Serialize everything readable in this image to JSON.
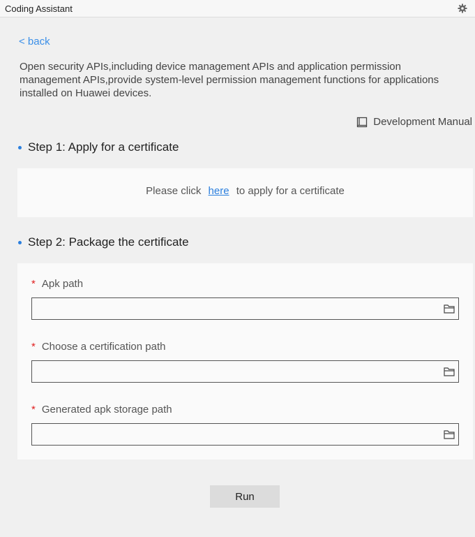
{
  "window": {
    "title": "Coding Assistant"
  },
  "nav": {
    "back_label": "< back"
  },
  "description": "Open security APIs,including device management APIs and application permission management APIs,provide system-level permission management functions for applications installed on Huawei devices.",
  "manual": {
    "label": "Development Manual"
  },
  "step1": {
    "title": "Step 1: Apply for a certificate",
    "text_before": "Please click",
    "link_label": "here",
    "text_after": "to apply for a certificate"
  },
  "step2": {
    "title": "Step 2: Package the certificate",
    "required_mark": "*",
    "fields": [
      {
        "label": "Apk path",
        "value": ""
      },
      {
        "label": "Choose a certification path",
        "value": ""
      },
      {
        "label": "Generated apk storage path",
        "value": ""
      }
    ]
  },
  "actions": {
    "run_label": "Run"
  },
  "colors": {
    "accent": "#2a7fde",
    "required": "#e02020",
    "button_bg": "#dcdcdc"
  }
}
